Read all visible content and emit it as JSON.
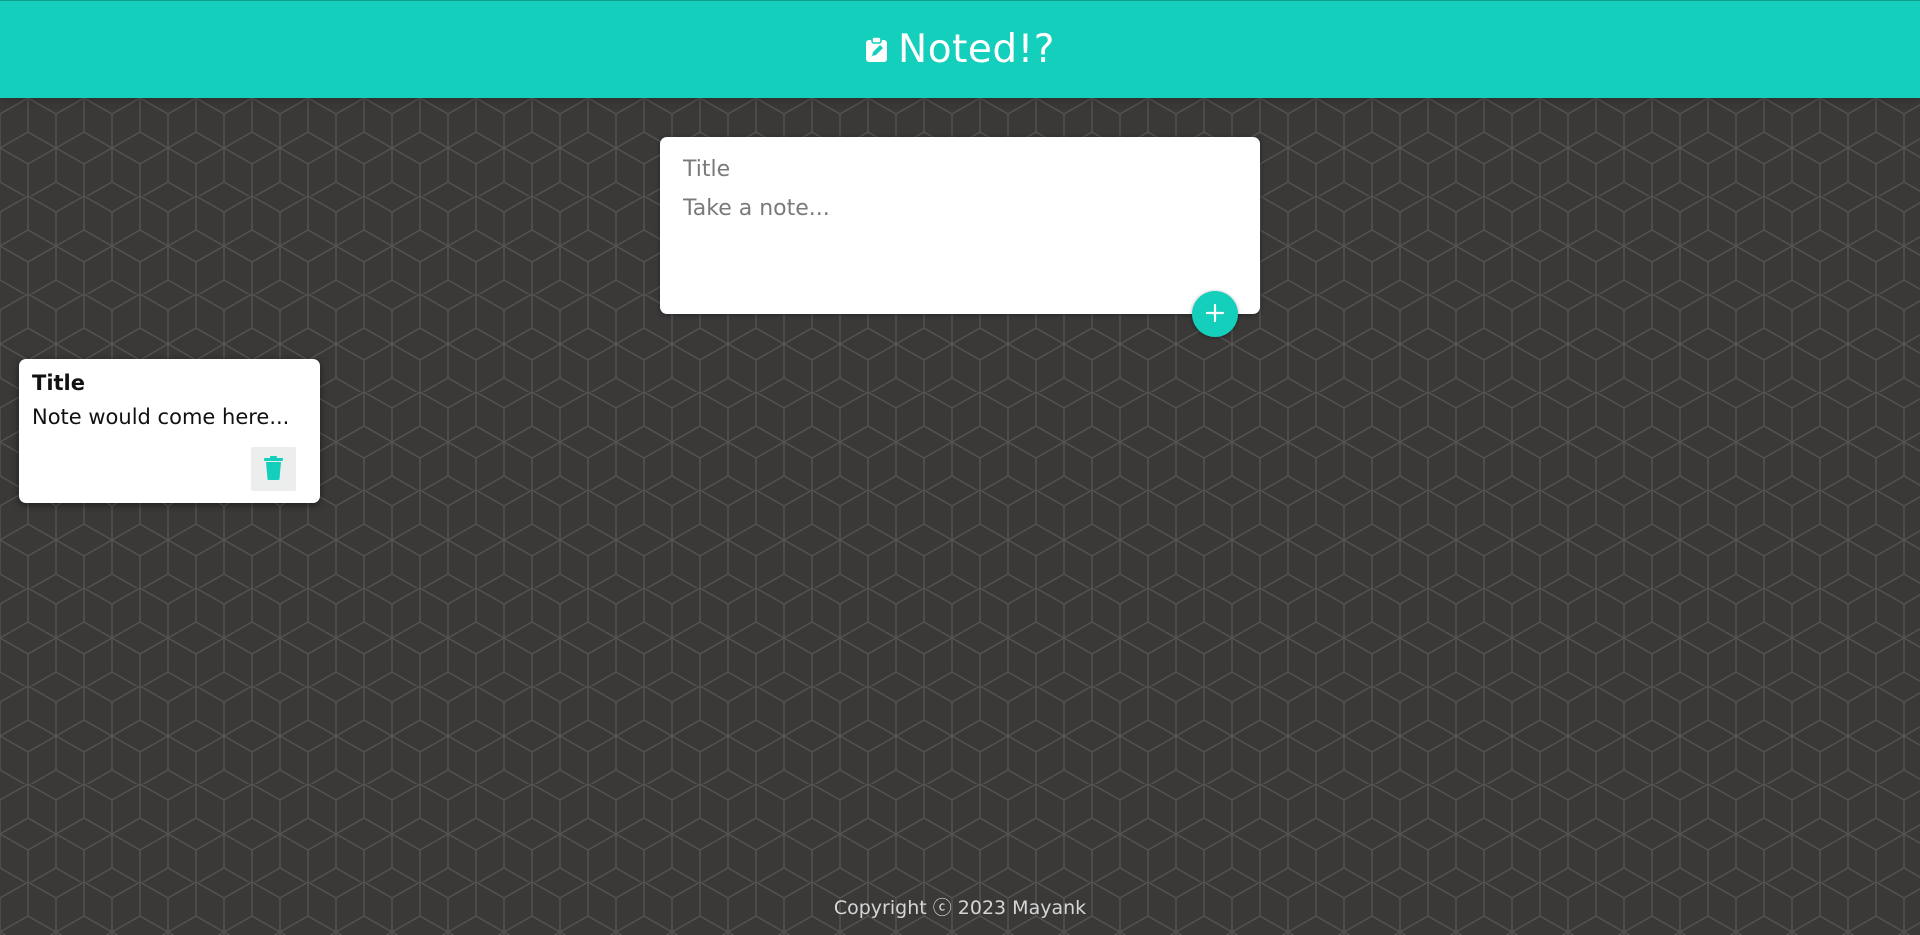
{
  "header": {
    "logo_icon": "clipboard-edit-icon",
    "title": "Noted!?"
  },
  "create_note": {
    "title_placeholder": "Title",
    "content_placeholder": "Take a note...",
    "add_icon": "plus-icon"
  },
  "notes": [
    {
      "title": "Title",
      "content": "Note would come here...",
      "delete_icon": "trash-icon"
    }
  ],
  "footer": {
    "text": "Copyright ⓒ 2023 Mayank"
  },
  "colors": {
    "accent": "#14cfbb",
    "background": "#3a3938",
    "card": "#ffffff"
  }
}
